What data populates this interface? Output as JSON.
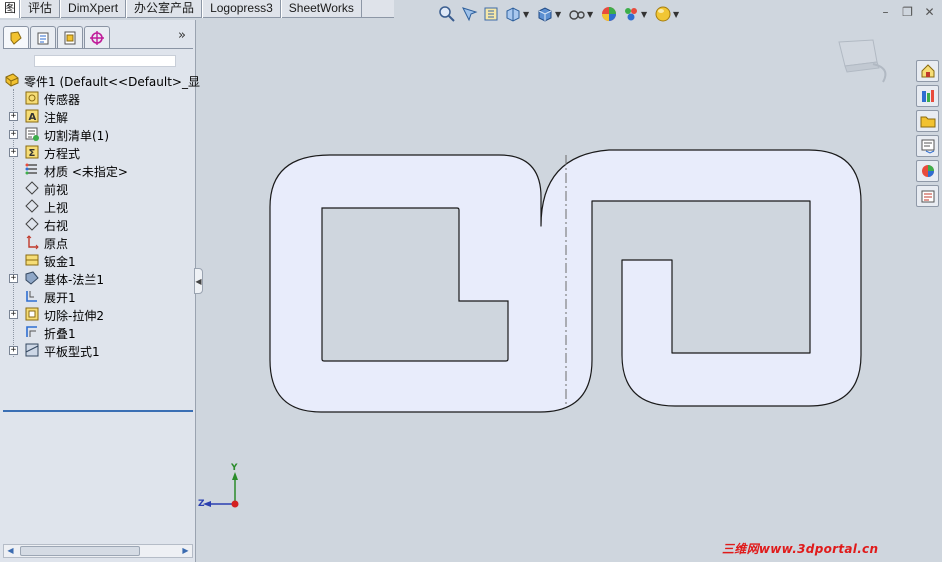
{
  "command_tabs": [
    {
      "label": "图"
    },
    {
      "label": "评估"
    },
    {
      "label": "DimXpert"
    },
    {
      "label": "办公室产品"
    },
    {
      "label": "Logopress3"
    },
    {
      "label": "SheetWorks"
    }
  ],
  "view_toolbar": [
    "zoom-to-fit-icon",
    "zoom-area-icon",
    "previous-view-icon",
    "section-view-icon",
    "view-orientation-icon",
    "display-style-icon",
    "hide-show-icon",
    "edit-appearance-icon",
    "apply-scene-icon",
    "view-settings-icon"
  ],
  "panel": {
    "tabs": [
      "featuremanager-icon",
      "propertymanager-icon",
      "configurationmanager-icon",
      "dimxpert-icon"
    ],
    "more": "»"
  },
  "tree": {
    "root": "零件1  (Default<<Default>_显",
    "items": [
      {
        "label": "传感器",
        "expandable": false,
        "icon": "sensor-icon"
      },
      {
        "label": "注解",
        "expandable": true,
        "icon": "annotation-icon"
      },
      {
        "label": "切割清单(1)",
        "expandable": true,
        "icon": "cut-list-icon"
      },
      {
        "label": "方程式",
        "expandable": true,
        "icon": "equation-icon"
      },
      {
        "label": "材质 <未指定>",
        "expandable": false,
        "icon": "material-icon"
      },
      {
        "label": "前视",
        "expandable": false,
        "icon": "plane-icon"
      },
      {
        "label": "上视",
        "expandable": false,
        "icon": "plane-icon"
      },
      {
        "label": "右视",
        "expandable": false,
        "icon": "plane-icon"
      },
      {
        "label": "原点",
        "expandable": false,
        "icon": "origin-icon"
      },
      {
        "label": "钣金1",
        "expandable": false,
        "icon": "sheet-metal-icon"
      },
      {
        "label": "基体-法兰1",
        "expandable": true,
        "icon": "base-flange-icon"
      },
      {
        "label": "展开1",
        "expandable": false,
        "icon": "unfold-icon"
      },
      {
        "label": "切除-拉伸2",
        "expandable": true,
        "icon": "cut-extrude-icon"
      },
      {
        "label": "折叠1",
        "expandable": false,
        "icon": "fold-icon"
      },
      {
        "label": "平板型式1",
        "expandable": true,
        "icon": "flat-pattern-icon"
      }
    ]
  },
  "triad": {
    "y": "Y",
    "z": "Z"
  },
  "task_pane": [
    "solidworks-resources-icon",
    "design-library-icon",
    "file-explorer-icon",
    "view-palette-icon",
    "appearances-icon",
    "custom-properties-icon"
  ],
  "watermark": "三维网www.3dportal.cn",
  "colors": {
    "part_fill": "#e8ecfb",
    "background": "#cfd6de",
    "panel": "#dfe4ec",
    "watermark": "#e01a1a"
  }
}
